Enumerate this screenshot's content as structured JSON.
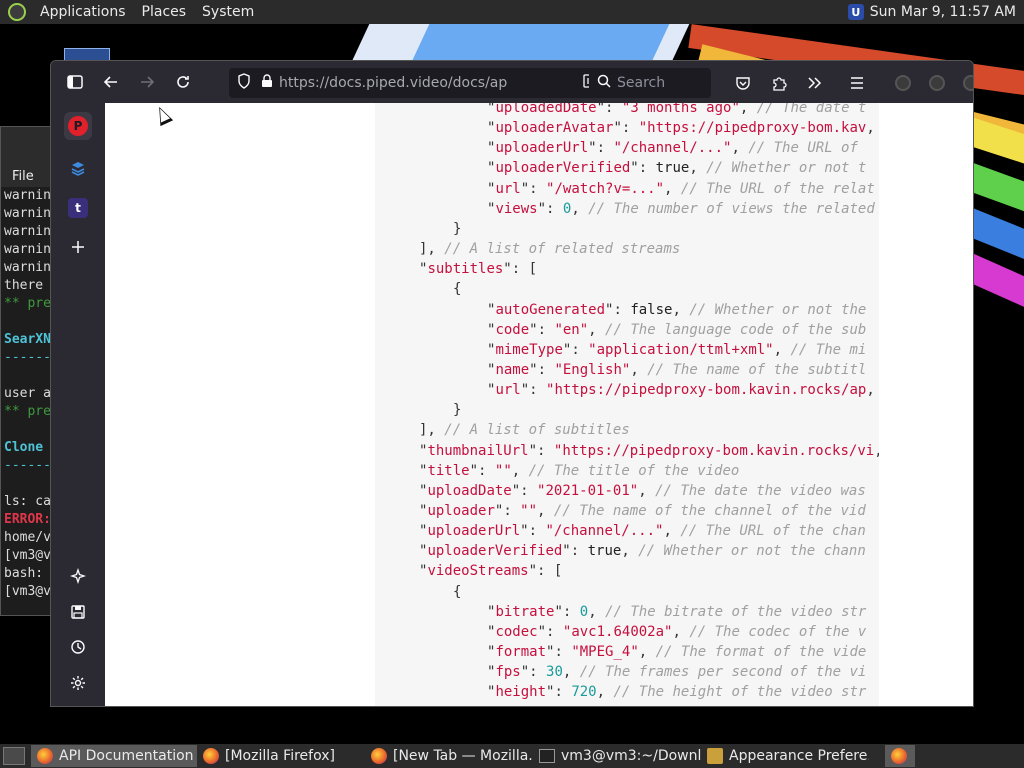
{
  "top_panel": {
    "menus": [
      "Applications",
      "Places",
      "System"
    ],
    "clock": "Sun Mar 9, 11:57 AM",
    "user_badge": "U"
  },
  "terminal": {
    "menu_file": "File",
    "lines": [
      {
        "text": "warnin",
        "color": "#dddddd"
      },
      {
        "text": "warnin",
        "color": "#dddddd"
      },
      {
        "text": "warnin",
        "color": "#dddddd"
      },
      {
        "text": "warnin",
        "color": "#dddddd"
      },
      {
        "text": "warnin",
        "color": "#dddddd"
      },
      {
        "text": " there",
        "color": "#dddddd"
      },
      {
        "text": "** pre",
        "color": "#3f9a3f"
      },
      {
        "text": "",
        "color": "#dddddd"
      },
      {
        "text": "SearXN",
        "color": "#4ec3d6"
      },
      {
        "text": "------",
        "color": "#4ec3d6"
      },
      {
        "text": "",
        "color": "#dddddd"
      },
      {
        "text": "user a",
        "color": "#dddddd"
      },
      {
        "text": "** pre",
        "color": "#3f9a3f"
      },
      {
        "text": "",
        "color": "#dddddd"
      },
      {
        "text": "Clone ",
        "color": "#4ec3d6"
      },
      {
        "text": "------",
        "color": "#4ec3d6"
      },
      {
        "text": "",
        "color": "#dddddd"
      },
      {
        "text": "ls: ca",
        "color": "#dddddd"
      },
      {
        "text": "ERROR:",
        "color": "#e0364a"
      },
      {
        "text": "home/v",
        "color": "#dddddd"
      },
      {
        "text": "[vm3@v",
        "color": "#dddddd"
      },
      {
        "text": "bash: ",
        "color": "#dddddd"
      },
      {
        "text": "[vm3@v",
        "color": "#dddddd"
      }
    ]
  },
  "browser": {
    "url": "https://docs.piped.video/docs/api-d",
    "search_placeholder": "Search",
    "sidebar_icons": [
      "piped-icon",
      "layers-icon",
      "tumblr-icon",
      "plus-icon",
      "sparkle-icon",
      "save-icon",
      "history-icon",
      "gear-icon"
    ],
    "tumblr_letter": "t",
    "piped_letter": "P"
  },
  "code_lines": [
    {
      "indent": 4,
      "key": "uploadedDate",
      "value": "\"3 months ago\"",
      "vtype": "s",
      "comment": "// The date t"
    },
    {
      "indent": 4,
      "key": "uploaderAvatar",
      "value": "\"https://pipedproxy-bom.kav",
      "vtype": "s",
      "comment": ""
    },
    {
      "indent": 4,
      "key": "uploaderUrl",
      "value": "\"/channel/...\"",
      "vtype": "s",
      "comment": "// The URL of"
    },
    {
      "indent": 4,
      "key": "uploaderVerified",
      "value": "true",
      "vtype": "b",
      "comment": "// Whether or not t"
    },
    {
      "indent": 4,
      "key": "url",
      "value": "\"/watch?v=...\"",
      "vtype": "s",
      "comment": "// The URL of the relat"
    },
    {
      "indent": 4,
      "key": "views",
      "value": "0",
      "vtype": "n",
      "comment": "// The number of views the related"
    },
    {
      "indent": 3,
      "raw": "}",
      "comment": ""
    },
    {
      "indent": 2,
      "raw": "],",
      "comment": "// A list of related streams"
    },
    {
      "indent": 2,
      "key": "subtitles",
      "raw_after": "[",
      "comment": ""
    },
    {
      "indent": 3,
      "raw": "{",
      "comment": ""
    },
    {
      "indent": 4,
      "key": "autoGenerated",
      "value": "false",
      "vtype": "b",
      "comment": "// Whether or not the"
    },
    {
      "indent": 4,
      "key": "code",
      "value": "\"en\"",
      "vtype": "s",
      "comment": "// The language code of the sub"
    },
    {
      "indent": 4,
      "key": "mimeType",
      "value": "\"application/ttml+xml\"",
      "vtype": "s",
      "comment": "// The mi"
    },
    {
      "indent": 4,
      "key": "name",
      "value": "\"English\"",
      "vtype": "s",
      "comment": "// The name of the subtitl"
    },
    {
      "indent": 4,
      "key": "url",
      "value": "\"https://pipedproxy-bom.kavin.rocks/ap",
      "vtype": "s",
      "comment": ""
    },
    {
      "indent": 3,
      "raw": "}",
      "comment": ""
    },
    {
      "indent": 2,
      "raw": "],",
      "comment": "// A list of subtitles"
    },
    {
      "indent": 2,
      "key": "thumbnailUrl",
      "value": "\"https://pipedproxy-bom.kavin.rocks/vi",
      "vtype": "s",
      "comment": ""
    },
    {
      "indent": 2,
      "key": "title",
      "value": "\"\"",
      "vtype": "s",
      "comment": "// The title of the video"
    },
    {
      "indent": 2,
      "key": "uploadDate",
      "value": "\"2021-01-01\"",
      "vtype": "s",
      "comment": "// The date the video was"
    },
    {
      "indent": 2,
      "key": "uploader",
      "value": "\"\"",
      "vtype": "s",
      "comment": "// The name of the channel of the vid"
    },
    {
      "indent": 2,
      "key": "uploaderUrl",
      "value": "\"/channel/...\"",
      "vtype": "s",
      "comment": "// The URL of the chan"
    },
    {
      "indent": 2,
      "key": "uploaderVerified",
      "value": "true",
      "vtype": "b",
      "comment": "// Whether or not the chann"
    },
    {
      "indent": 2,
      "key": "videoStreams",
      "raw_after": "[",
      "comment": ""
    },
    {
      "indent": 3,
      "raw": "{",
      "comment": ""
    },
    {
      "indent": 4,
      "key": "bitrate",
      "value": "0",
      "vtype": "n",
      "comment": "// The bitrate of the video str"
    },
    {
      "indent": 4,
      "key": "codec",
      "value": "\"avc1.64002a\"",
      "vtype": "s",
      "comment": "// The codec of the v"
    },
    {
      "indent": 4,
      "key": "format",
      "value": "\"MPEG_4\"",
      "vtype": "s",
      "comment": "// The format of the vide"
    },
    {
      "indent": 4,
      "key": "fps",
      "value": "30",
      "vtype": "n",
      "comment": "// The frames per second of the vi"
    },
    {
      "indent": 4,
      "key": "height",
      "value": "720",
      "vtype": "n",
      "comment": "// The height of the video str"
    }
  ],
  "taskbar": {
    "tasks": [
      {
        "label": "API Documentation ...",
        "icon": "firefox-icon",
        "active": true
      },
      {
        "label": "[Mozilla Firefox]",
        "icon": "firefox-icon",
        "active": false
      },
      {
        "label": "[New Tab — Mozilla...",
        "icon": "firefox-icon",
        "active": false
      },
      {
        "label": "vm3@vm3:~/Downl...",
        "icon": "terminal-icon",
        "active": false
      },
      {
        "label": "Appearance Prefere...",
        "icon": "preferences-icon",
        "active": false
      }
    ]
  }
}
